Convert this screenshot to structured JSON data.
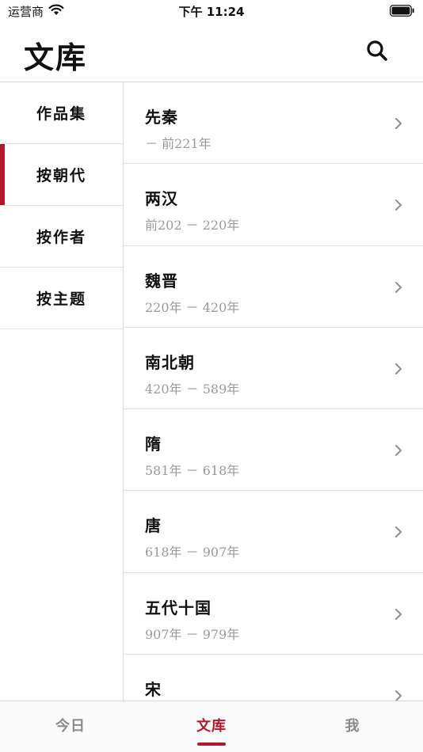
{
  "status_bar": {
    "carrier": "运营商",
    "time": "下午 11:24",
    "wifi_icon": "wifi-icon",
    "battery_icon": "battery-icon"
  },
  "header": {
    "title": "文库",
    "search_icon": "search-icon"
  },
  "sidebar": {
    "items": [
      {
        "label": "作品集",
        "active": false
      },
      {
        "label": "按朝代",
        "active": true
      },
      {
        "label": "按作者",
        "active": false
      },
      {
        "label": "按主题",
        "active": false
      }
    ]
  },
  "list": {
    "rows": [
      {
        "title": "先秦",
        "range": "－ 前221年"
      },
      {
        "title": "两汉",
        "range": "前202 － 220年"
      },
      {
        "title": "魏晋",
        "range": "220年 － 420年"
      },
      {
        "title": "南北朝",
        "range": "420年 － 589年"
      },
      {
        "title": "隋",
        "range": "581年 － 618年"
      },
      {
        "title": "唐",
        "range": "618年 － 907年"
      },
      {
        "title": "五代十国",
        "range": "907年 － 979年"
      },
      {
        "title": "宋",
        "range": ""
      }
    ]
  },
  "tab_bar": {
    "tabs": [
      {
        "label": "今日",
        "active": false
      },
      {
        "label": "文库",
        "active": true
      },
      {
        "label": "我",
        "active": false
      }
    ]
  },
  "colors": {
    "accent": "#b0192b",
    "divider": "#d9d9d9",
    "subtext": "#9a9a9a"
  }
}
